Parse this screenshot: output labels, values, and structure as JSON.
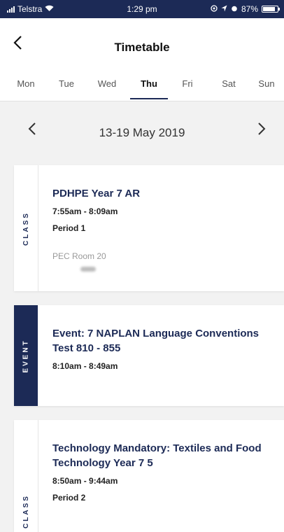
{
  "status_bar": {
    "carrier": "Telstra",
    "time": "1:29 pm",
    "battery": "87%",
    "battery_level": 0.87
  },
  "header": {
    "title": "Timetable"
  },
  "tabs": [
    {
      "label": "Mon",
      "active": false
    },
    {
      "label": "Tue",
      "active": false
    },
    {
      "label": "Wed",
      "active": false
    },
    {
      "label": "Thu",
      "active": true
    },
    {
      "label": "Fri",
      "active": false
    },
    {
      "label": "Sat",
      "active": false
    },
    {
      "label": "Sun",
      "active": false
    }
  ],
  "week": {
    "range": "13-19 May 2019"
  },
  "items": [
    {
      "kind": "CLASS",
      "name": "PDHPE Year 7 AR",
      "time": "7:55am - 8:09am",
      "period": "Period 1",
      "room": "PEC Room 20"
    },
    {
      "kind": "EVENT",
      "name": "Event: 7 NAPLAN Language Conventions Test 810 - 855",
      "time": "8:10am - 8:49am"
    },
    {
      "kind": "CLASS",
      "name": "Technology Mandatory: Textiles and Food Technology Year 7 5",
      "time": "8:50am - 9:44am",
      "period": "Period 2"
    }
  ],
  "colors": {
    "accent": "#1c2a56",
    "background": "#f2f2f2"
  }
}
